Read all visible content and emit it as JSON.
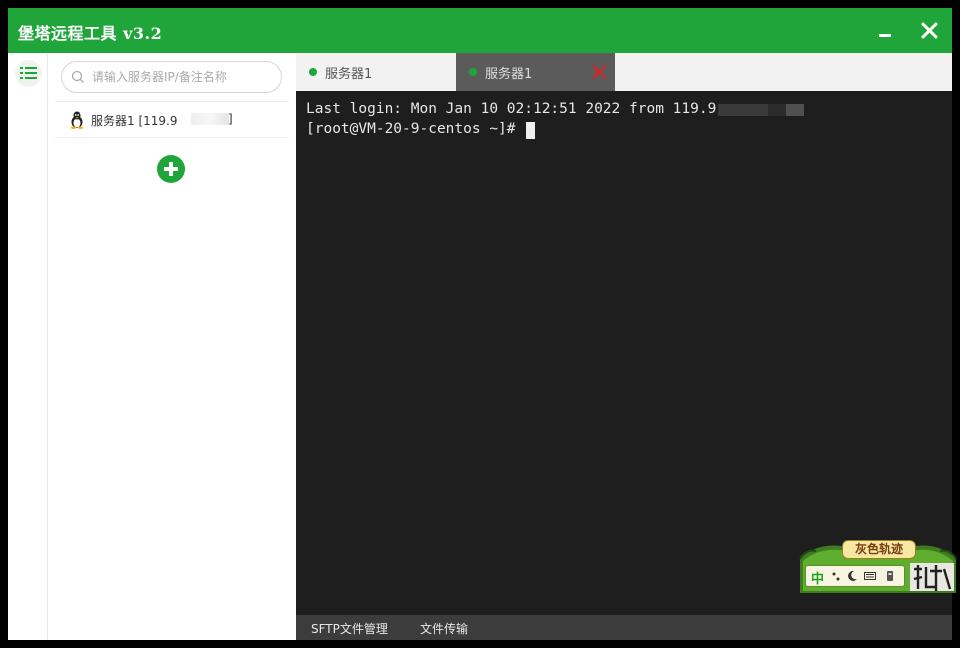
{
  "app": {
    "title": "堡塔远程工具 v3.2",
    "accent_color": "#20a53a"
  },
  "window_controls": {
    "minimize_icon": "minimize-icon",
    "close_icon": "close-icon"
  },
  "rail": {
    "menu_icon": "list-icon"
  },
  "search": {
    "placeholder": "请输入服务器IP/备注名称",
    "value": ""
  },
  "servers": [
    {
      "name": "服务器1 [119.9",
      "suffix": "]",
      "os_icon": "linux-tux-icon"
    }
  ],
  "add_button_icon": "plus-icon",
  "tabs": [
    {
      "label": "服务器1",
      "status_color": "#20a53a",
      "active": false
    },
    {
      "label": "服务器1",
      "status_color": "#20a53a",
      "active": true,
      "close_icon": "close-icon"
    }
  ],
  "terminal": {
    "lines": [
      "Last login: Mon Jan 10 02:12:51 2022 from 119.9",
      "[root@VM-20-9-centos ~]# "
    ]
  },
  "bottom_bar": {
    "sftp": "SFTP文件管理",
    "transfer": "文件传输"
  },
  "ime": {
    "title": "灰色轨迹",
    "lang": "中",
    "brand": "诛仙"
  }
}
